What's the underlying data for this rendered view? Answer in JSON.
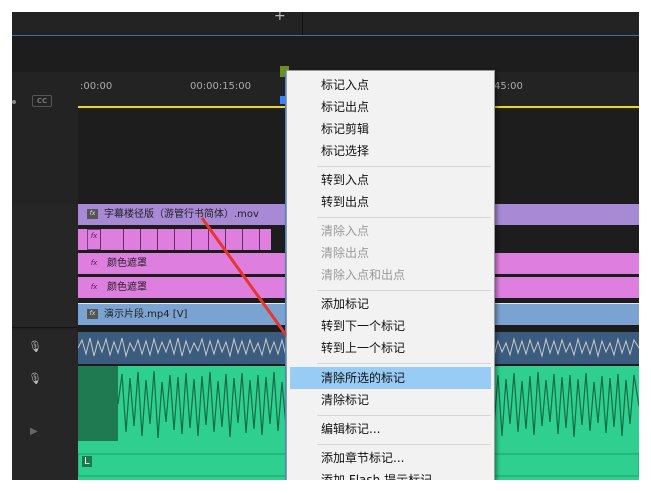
{
  "timeline": {
    "cc_label": "CC",
    "ruler_ticks": [
      ":00:00",
      "00:00:15:00",
      "45:00"
    ],
    "tracks": {
      "v4_clip": {
        "label": "字幕楼径版（游管行书简体）.mov"
      },
      "v2_clip": {
        "label": "颜色遮罩"
      },
      "v1b_clip": {
        "label": "颜色遮罩"
      },
      "v1_clip": {
        "label": "演示片段.mp4 [V]"
      },
      "a_label": "L"
    },
    "fx_glyph": "fx",
    "side_glyphs": {
      "mic": "🎙",
      "play": "▶"
    }
  },
  "context_menu": {
    "items": [
      {
        "label": "标记入点",
        "enabled": true
      },
      {
        "label": "标记出点",
        "enabled": true
      },
      {
        "label": "标记剪辑",
        "enabled": true
      },
      {
        "label": "标记选择",
        "enabled": true
      },
      {
        "label": "转到入点",
        "enabled": true
      },
      {
        "label": "转到出点",
        "enabled": true
      },
      {
        "label": "清除入点",
        "enabled": false
      },
      {
        "label": "清除出点",
        "enabled": false
      },
      {
        "label": "清除入点和出点",
        "enabled": false
      },
      {
        "label": "添加标记",
        "enabled": true
      },
      {
        "label": "转到下一个标记",
        "enabled": true
      },
      {
        "label": "转到上一个标记",
        "enabled": true
      },
      {
        "label": "清除所选的标记",
        "enabled": true,
        "highlighted": true
      },
      {
        "label": "清除标记",
        "enabled": true
      },
      {
        "label": "编辑标记...",
        "enabled": true
      },
      {
        "label": "添加章节标记...",
        "enabled": true
      },
      {
        "label": "添加 Flash 提示标记",
        "enabled": true
      }
    ]
  },
  "colors": {
    "highlight": "#99ccf5",
    "arrow": "#e8362a",
    "track_video_clip": "#de7fe0",
    "track_title_clip": "#a889d6",
    "track_audio": "#2fd08f",
    "playhead": "#4a90e2"
  }
}
